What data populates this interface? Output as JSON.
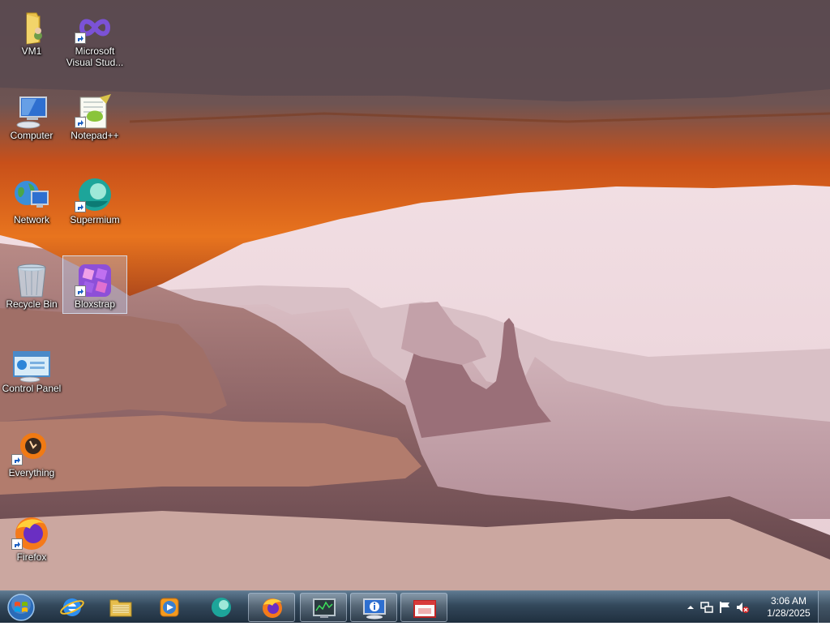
{
  "desktop": {
    "icons": [
      {
        "label": "VM1",
        "icon": "folder-user-icon"
      },
      {
        "label": "Microsoft Visual Stud...",
        "icon": "visual-studio-icon"
      },
      {
        "label": "Computer",
        "icon": "computer-icon"
      },
      {
        "label": "Notepad++",
        "icon": "notepad-plus-plus-icon"
      },
      {
        "label": "Network",
        "icon": "network-icon"
      },
      {
        "label": "Supermium",
        "icon": "supermium-icon"
      },
      {
        "label": "Recycle Bin",
        "icon": "recycle-bin-icon"
      },
      {
        "label": "Bloxstrap",
        "icon": "bloxstrap-icon",
        "selected": true
      },
      {
        "label": "Control Panel",
        "icon": "control-panel-icon"
      },
      {
        "label": "Everything",
        "icon": "everything-search-icon"
      },
      {
        "label": "Firefox",
        "icon": "firefox-icon"
      }
    ]
  },
  "taskbar": {
    "pinned": [
      {
        "name": "Internet Explorer",
        "icon": "internet-explorer-icon",
        "running": false
      },
      {
        "name": "Windows Explorer",
        "icon": "folder-explorer-icon",
        "running": false
      },
      {
        "name": "Windows Media Player",
        "icon": "media-player-icon",
        "running": false
      },
      {
        "name": "Supermium",
        "icon": "supermium-icon",
        "running": false
      },
      {
        "name": "Firefox",
        "icon": "firefox-icon",
        "running": true
      },
      {
        "name": "Task Manager",
        "icon": "task-manager-icon",
        "running": true
      },
      {
        "name": "System Information",
        "icon": "system-info-icon",
        "running": true
      },
      {
        "name": "Remote Desktop",
        "icon": "remote-desktop-icon",
        "running": true
      }
    ],
    "clock": {
      "time": "3:06 AM",
      "date": "1/28/2025"
    },
    "tray": [
      "show-hidden-icons-icon",
      "network-tray-icon",
      "action-center-flag-icon",
      "volume-muted-icon"
    ]
  }
}
